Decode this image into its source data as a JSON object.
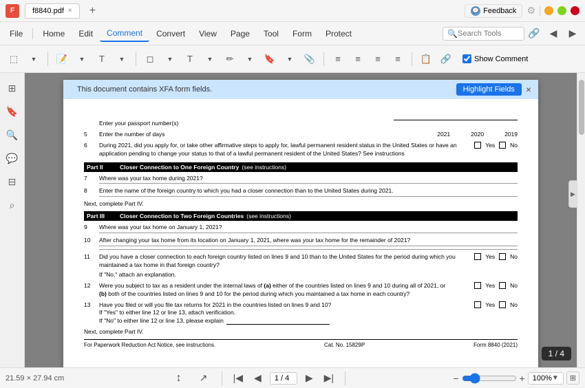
{
  "titleBar": {
    "appName": "f8840.pdf",
    "closeTabLabel": "×",
    "addTabLabel": "+",
    "feedbackLabel": "Feedback",
    "minimizeLabel": "−",
    "maximizeLabel": "□",
    "closeLabel": "✕"
  },
  "menuBar": {
    "file": "File",
    "home": "Home",
    "edit": "Edit",
    "comment": "Comment",
    "convert": "Convert",
    "view": "View",
    "page": "Page",
    "tool": "Tool",
    "form": "Form",
    "protect": "Protect"
  },
  "toolbar": {
    "searchPlaceholder": "Search Tools",
    "showCommentLabel": "Show Comment"
  },
  "xfaBanner": {
    "text": "This document contains XFA form fields.",
    "highlightBtn": "Highlight Fields",
    "closeBtn": "×"
  },
  "pdfContent": {
    "line4": "Enter your passport number(s)",
    "line5label": "5",
    "line5text": "Enter the number of days",
    "year1": "2021",
    "year2": "2020",
    "year3": "2019",
    "line6num": "6",
    "line6text": "During 2021, did you apply for, or take other affirmative steps to apply for, lawful permanent resident status in the United States or have an application pending to change your status to that of a lawful permanent resident of the United States? See instructions",
    "line6yes": "Yes",
    "line6no": "No",
    "part2label": "Part II",
    "part2title": "Closer Connection to One Foreign Country",
    "part2instruct": "(see instructions)",
    "line7num": "7",
    "line7text": "Where was your tax home during 2021?",
    "line8num": "8",
    "line8text": "Enter the name of the foreign country to which you had a closer connection than to the United States during 2021.",
    "nextCompleteIV": "Next, complete Part IV.",
    "part3label": "Part III",
    "part3title": "Closer Connection to Two Foreign Countries",
    "part3instruct": "(see instructions)",
    "line9num": "9",
    "line9text": "Where was your tax home on January 1, 2021?",
    "line10num": "10",
    "line10text": "After changing your tax home from its location on January 1, 2021, where was your tax home for the remainder of 2021?",
    "line11num": "11",
    "line11pretext": "Did you have a closer connection to each foreign country listed on lines 9 and 10 than to the United States for the period during which you maintained a tax home in that foreign country?",
    "line11subtext": "If \"No,\" attach an explanation.",
    "line11yes": "Yes",
    "line11no": "No",
    "line12num": "12",
    "line12text": "Were you subject to tax as a resident under the internal laws of",
    "line12a": "(a)",
    "line12atext": "either of the countries listed on lines 9 and 10 during all of 2021, or",
    "line12b": "(b)",
    "line12btext": "both of the countries listed on lines 9 and 10 for the period during which you maintained a tax home in each country?",
    "line12yes": "Yes",
    "line12no": "No",
    "line13num": "13",
    "line13text": "Have you filed or will you file tax returns for 2021 in the countries listed on lines 9 and 10?",
    "line13yes": "Yes",
    "line13no": "No",
    "line13sub1": "If \"Yes\" to either line 12 or line 13, attach verification.",
    "line13sub2": "If \"No\" to either line 12 or line 13, please explain",
    "nextCompleteIV2": "Next, complete Part IV.",
    "footerLeft": "For Paperwork Reduction Act Notice, see instructions.",
    "footerCat": "Cat. No. 15829P",
    "footerForm": "Form 8840",
    "footerYear": "(2021)"
  },
  "bottomBar": {
    "dimensions": "21.59 × 27.94 cm",
    "pageDisplay": "1 / 4",
    "zoomPercent": "100%"
  },
  "pageIndicator": "1 / 4"
}
